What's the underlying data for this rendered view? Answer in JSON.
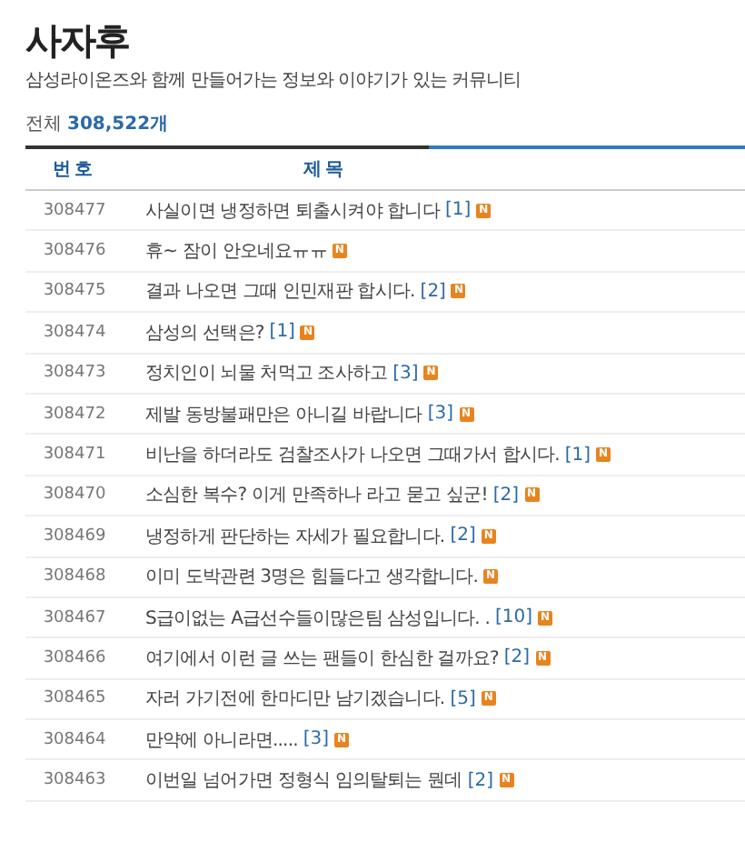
{
  "board": {
    "title": "사자후",
    "subtitle": "삼성라이온즈와 함께 만들어가는 정보와 이야기가 있는 커뮤니티",
    "total_label": "전체",
    "total_count": "308,522",
    "total_unit": "개"
  },
  "table": {
    "columns": [
      "번호",
      "제목"
    ],
    "rows": [
      {
        "number": "308477",
        "subject": {
          "title": "사실이면 냉정하면 퇴출시켜야 합니다",
          "comments": "[1]",
          "badge": "N"
        }
      },
      {
        "number": "308476",
        "subject": {
          "title": "휴~ 잠이 안오네요ㅠㅠ",
          "badge": "N"
        }
      },
      {
        "number": "308475",
        "subject": {
          "title": "결과 나오면 그때 인민재판 합시다.",
          "comments": "[2]",
          "badge": "N"
        }
      },
      {
        "number": "308474",
        "subject": {
          "title": "삼성의 선택은?",
          "comments": "[1]",
          "badge": "N"
        }
      },
      {
        "number": "308473",
        "subject": {
          "title": "정치인이 뇌물 처먹고 조사하고",
          "comments": "[3]",
          "badge": "N"
        }
      },
      {
        "number": "308472",
        "subject": {
          "title": "제발 동방불패만은 아니길 바랍니다",
          "comments": "[3]",
          "badge": "N"
        }
      },
      {
        "number": "308471",
        "subject": {
          "title": "비난을 하더라도 검찰조사가 나오면 그때가서 합시다.",
          "comments": "[1]",
          "badge": "N"
        }
      },
      {
        "number": "308470",
        "subject": {
          "title": "소심한 복수? 이게 만족하나 라고 묻고 싶군!",
          "comments": "[2]",
          "badge": "N"
        }
      },
      {
        "number": "308469",
        "subject": {
          "title": "냉정하게 판단하는 자세가 필요합니다.",
          "comments": "[2]",
          "badge": "N"
        }
      },
      {
        "number": "308468",
        "subject": {
          "title": "이미 도박관련 3명은 힘들다고 생각합니다.",
          "badge": "N"
        }
      },
      {
        "number": "308467",
        "subject": {
          "title": "S급이없는 A급선수들이많은팀 삼성입니다. .",
          "comments": "[10]",
          "badge": "N"
        }
      },
      {
        "number": "308466",
        "subject": {
          "title": "여기에서 이런 글 쓰는 팬들이 한심한 걸까요?",
          "comments": "[2]",
          "badge": "N"
        }
      },
      {
        "number": "308465",
        "subject": {
          "title": "자러 가기전에 한마디만 남기겠습니다.",
          "comments": "[5]",
          "badge": "N"
        }
      },
      {
        "number": "308464",
        "subject": {
          "title": "만약에 아니라면.....",
          "comments": "[3]",
          "badge": "N"
        }
      },
      {
        "number": "308463",
        "subject": {
          "title": "이번일 넘어가면 정형식 임의탈퇴는 뭔데",
          "comments": "[2]",
          "badge": "N"
        }
      }
    ]
  }
}
